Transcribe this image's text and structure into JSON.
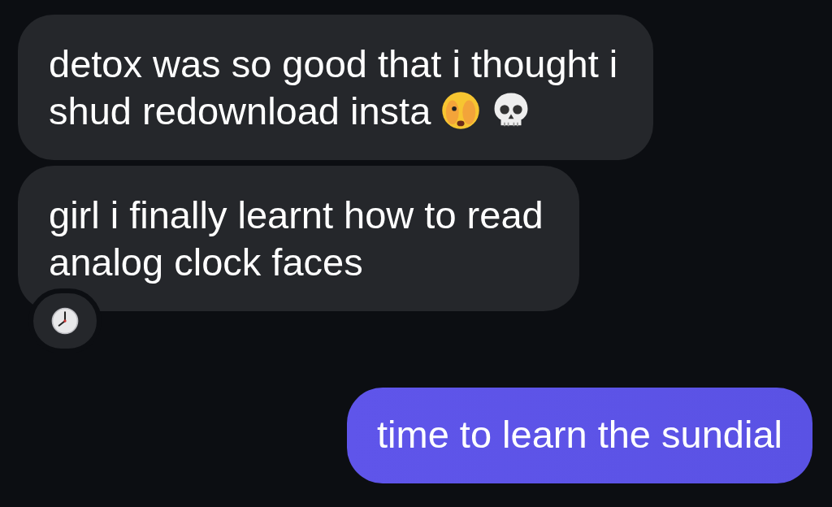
{
  "messages": [
    {
      "kind": "incoming",
      "lines": [
        "detox was so good that i thought i",
        "shud redownload insta"
      ],
      "emoji_icons": [
        {
          "kind": "peeking-face"
        },
        {
          "kind": "skull"
        }
      ]
    },
    {
      "kind": "incoming",
      "lines": [
        "girl i finally learnt how to read",
        "analog clock faces"
      ],
      "reaction": {
        "kind": "clock"
      }
    },
    {
      "kind": "outgoing",
      "lines": [
        "time to learn the sundial"
      ]
    }
  ]
}
